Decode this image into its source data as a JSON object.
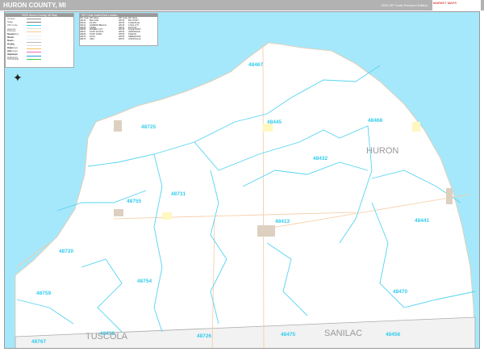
{
  "header": {
    "title": "HURON COUNTY, MI",
    "edition": "2020 ZIP Code Premium Edition",
    "logo": "MARKET MAPS"
  },
  "legend": {
    "title": "2020 Huron County, MI Map",
    "items": [
      "County",
      "State",
      "ZIP Code",
      "Airports",
      "Primary Roads",
      "Secondary Roads",
      "Minor Roads",
      "Rail Roads",
      "County Highways",
      "State Highways",
      "US Highways",
      "Interstate Highways",
      "Toll Roads"
    ],
    "colors": [
      "#999999",
      "#777777",
      "#33ccee",
      "#dddddd",
      "#f5c9a0",
      "#eeeeee",
      "#eeeeee",
      "#bbbbbb",
      "#dddddd",
      "#f5c060",
      "#ee66bb",
      "#3399dd",
      "#44cc44"
    ]
  },
  "zip_table": {
    "title": "ZIP Code Index/Grid Locator",
    "col_zip": "ZIP Code",
    "col_name": "ZIP Name",
    "rows": [
      [
        "48413",
        "BAD AXE"
      ],
      [
        "48432",
        "FILION"
      ],
      [
        "48441",
        "HARBOR BEACH"
      ],
      [
        "48445",
        "KINDE"
      ],
      [
        "48456",
        "MINDEN CITY"
      ],
      [
        "48467",
        "PORT AUSTIN"
      ],
      [
        "48468",
        "PORT HOPE"
      ],
      [
        "48470",
        "RUTH"
      ],
      [
        "48475",
        "UBLY"
      ],
      [
        "48720",
        "BAY PORT"
      ],
      [
        "48725",
        "CASEVILLE"
      ],
      [
        "48726",
        "CASS CITY"
      ],
      [
        "48731",
        "ELKTON"
      ],
      [
        "48735",
        "GAGETOWN"
      ],
      [
        "48754",
        "OWENDALE"
      ],
      [
        "48755",
        "PIGEON"
      ],
      [
        "48759",
        "SEBEWAING"
      ],
      [
        "48767",
        "UNIONVILLE"
      ]
    ]
  },
  "map": {
    "counties": [
      "HURON",
      "TUSCOLA",
      "SANILAC"
    ],
    "zips": [
      "48467",
      "48445",
      "48468",
      "48725",
      "48432",
      "48731",
      "48755",
      "48413",
      "48441",
      "48720",
      "48754",
      "48759",
      "48470",
      "48767",
      "48735",
      "48726",
      "48475",
      "48456"
    ],
    "colors": {
      "water": "#a6e8fb",
      "land": "#ffffff",
      "adjacent": "#f2f2f2",
      "zip_boundary": "#55d4f0",
      "road": "#f5c9a0"
    }
  }
}
